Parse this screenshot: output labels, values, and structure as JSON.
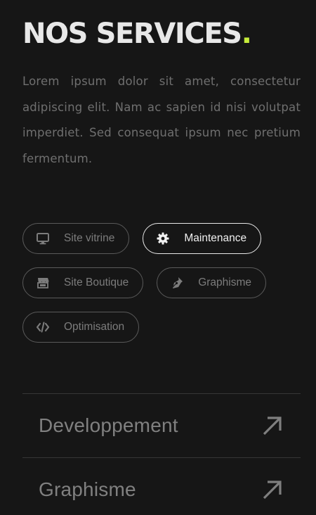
{
  "header": {
    "title": "NOS SERVICES",
    "title_dot": ".",
    "accent_color": "#c6ec3b"
  },
  "intro": {
    "text": "Lorem ipsum dolor sit amet, consectetur adipiscing elit. Nam ac sapien id nisi volutpat imperdiet. Sed consequat ipsum nec pretium fermentum."
  },
  "chips": [
    {
      "label": "Site vitrine",
      "icon": "monitor-icon",
      "active": false
    },
    {
      "label": "Maintenance",
      "icon": "gear-icon",
      "active": true
    },
    {
      "label": "Site Boutique",
      "icon": "store-icon",
      "active": false
    },
    {
      "label": "Graphisme",
      "icon": "pen-nib-icon",
      "active": false
    },
    {
      "label": "Optimisation",
      "icon": "code-icon",
      "active": false
    }
  ],
  "accordion": [
    {
      "label": "Developpement",
      "icon": "arrow-up-right-icon"
    },
    {
      "label": "Graphisme",
      "icon": "arrow-up-right-icon"
    }
  ]
}
